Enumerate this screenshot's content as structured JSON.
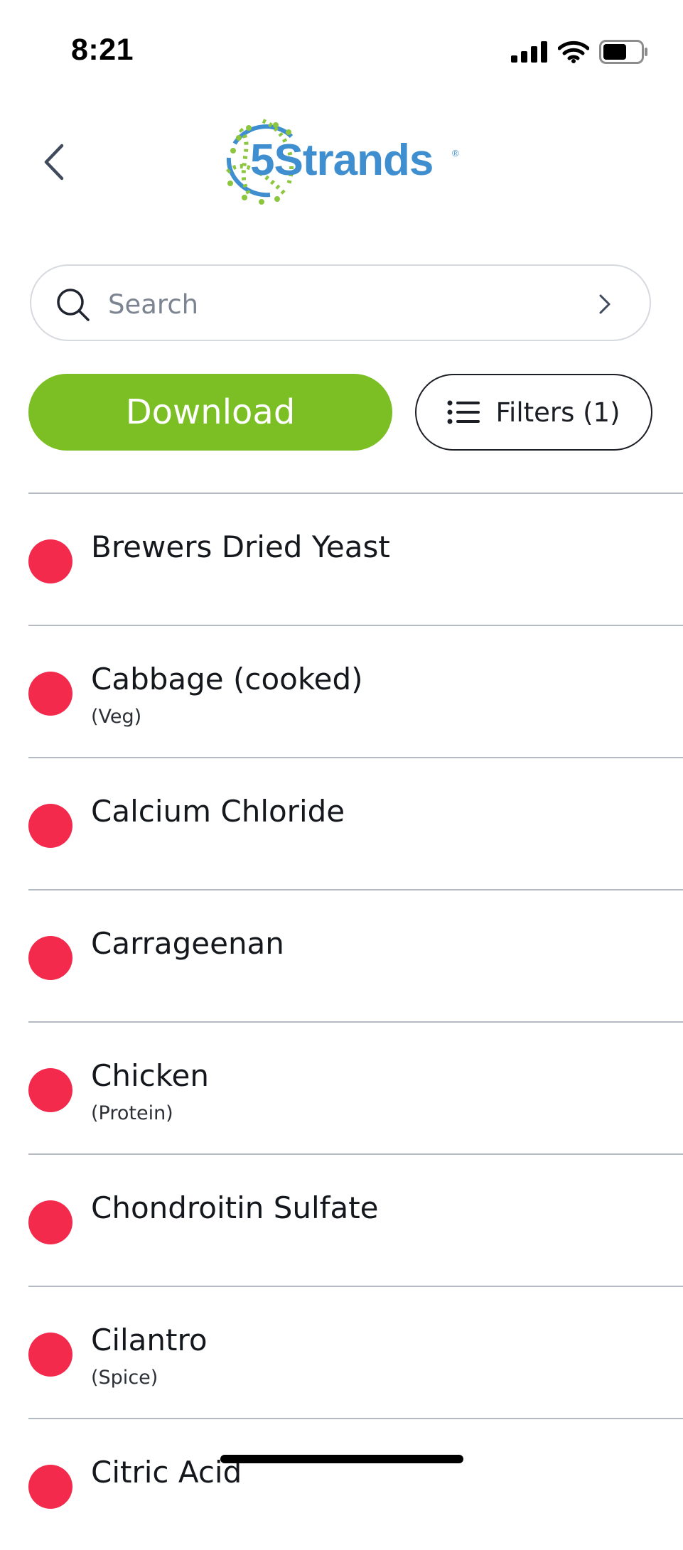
{
  "status_bar": {
    "time": "8:21"
  },
  "header": {
    "logo_text": "5Strands",
    "logo_mark": "®",
    "back_icon": "chevron-left-icon"
  },
  "search": {
    "placeholder": "Search",
    "value": ""
  },
  "actions": {
    "download_label": "Download",
    "filters_label": "Filters (1)"
  },
  "colors": {
    "accent_green": "#7cbf25",
    "status_red": "#f42a4d",
    "logo_blue": "#3f8fd0"
  },
  "items": [
    {
      "name": "Brewers Dried Yeast",
      "category": ""
    },
    {
      "name": "Cabbage (cooked)",
      "category": "(Veg)"
    },
    {
      "name": "Calcium Chloride",
      "category": ""
    },
    {
      "name": "Carrageenan",
      "category": ""
    },
    {
      "name": "Chicken",
      "category": "(Protein)"
    },
    {
      "name": "Chondroitin Sulfate",
      "category": ""
    },
    {
      "name": "Cilantro",
      "category": "(Spice)"
    },
    {
      "name": "Citric Acid",
      "category": ""
    }
  ]
}
